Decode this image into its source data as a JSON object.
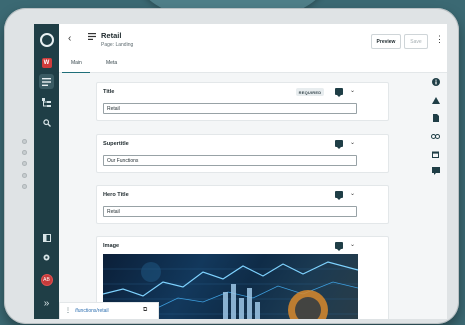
{
  "header": {
    "title": "Retail",
    "subtitle": "Page: Landing",
    "preview_label": "Preview",
    "save_label": "Save"
  },
  "rail": {
    "badge": "W",
    "avatar": "AB"
  },
  "tabs": [
    {
      "label": "Main",
      "active": true
    },
    {
      "label": "Meta",
      "active": false
    }
  ],
  "fields": {
    "title": {
      "label": "Title",
      "badge": "REQUIRED",
      "value": "Retail"
    },
    "supertitle": {
      "label": "Supertitle",
      "value": "Our Functions"
    },
    "hero_title": {
      "label": "Hero Title",
      "value": "Retail"
    },
    "image": {
      "label": "Image"
    }
  },
  "footer": {
    "path": "/functions/retail"
  },
  "icons": {
    "rail": [
      "logo-icon",
      "w-badge",
      "page-list-icon",
      "tree-icon",
      "search-icon",
      "panel-icon",
      "gear-icon",
      "avatar-icon",
      "expand-icon"
    ],
    "right": [
      "info-icon",
      "warning-icon",
      "document-icon",
      "link-icon",
      "calendar-icon",
      "comment-icon"
    ]
  }
}
